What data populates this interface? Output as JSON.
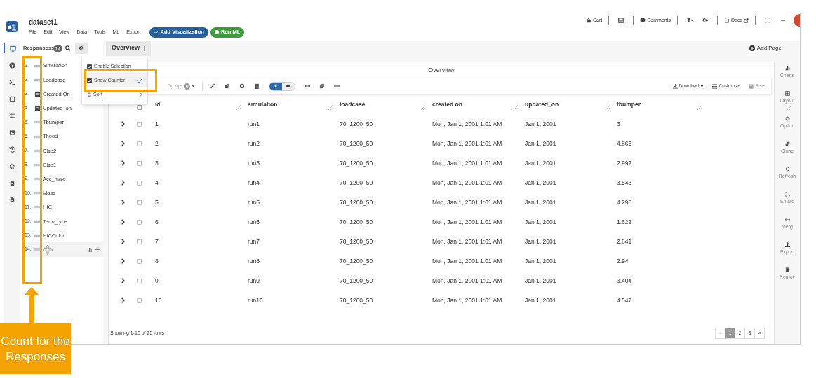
{
  "app": {
    "title": "dataset1",
    "menu": [
      "File",
      "Edit",
      "View",
      "Data",
      "Tools",
      "ML",
      "Export"
    ],
    "buttons": [
      {
        "label": "Add Visualization",
        "kind": "visualize"
      },
      {
        "label": "Run ML",
        "kind": "ml"
      }
    ]
  },
  "topbar": [
    {
      "kind": "cart",
      "label": "Cart"
    },
    {
      "kind": "sep"
    },
    {
      "kind": "table"
    },
    {
      "kind": "sep"
    },
    {
      "kind": "comments",
      "label": "Comments"
    },
    {
      "kind": "sep"
    },
    {
      "kind": "filter"
    },
    {
      "kind": "gear"
    },
    {
      "kind": "sep"
    },
    {
      "kind": "docs",
      "label": "Docs"
    },
    {
      "kind": "sep"
    },
    {
      "kind": "expand"
    },
    {
      "kind": "minimize"
    }
  ],
  "left_rail": [
    {
      "kind": "screen",
      "selected": true
    },
    {
      "kind": "info",
      "selected": false
    },
    {
      "kind": "terminal",
      "selected": false
    },
    {
      "kind": "square",
      "selected": false
    },
    {
      "kind": "sliders",
      "selected": false
    },
    {
      "kind": "image",
      "selected": false
    },
    {
      "kind": "history",
      "selected": false
    },
    {
      "kind": "gear",
      "selected": false
    },
    {
      "kind": "file",
      "selected": false
    },
    {
      "kind": "file",
      "selected": false
    }
  ],
  "responses": {
    "label": "Responses:",
    "count": "14",
    "items": [
      {
        "number": "1.",
        "kind": "text",
        "name": "Simulation",
        "hovered": false
      },
      {
        "number": "2.",
        "kind": "text",
        "name": "Loadcase",
        "hovered": false
      },
      {
        "number": "3.",
        "kind": "date",
        "name": "Created On",
        "hovered": false
      },
      {
        "number": "4.",
        "kind": "date",
        "name": "Updated_on",
        "hovered": false
      },
      {
        "number": "5.",
        "kind": "number",
        "name": "Tbumper",
        "hovered": false
      },
      {
        "number": "6.",
        "kind": "number",
        "name": "Thood",
        "hovered": false
      },
      {
        "number": "7.",
        "kind": "number",
        "name": "Disp2",
        "hovered": false
      },
      {
        "number": "8.",
        "kind": "number",
        "name": "Disp1",
        "hovered": false
      },
      {
        "number": "9.",
        "kind": "number",
        "name": "Acc_max",
        "hovered": false
      },
      {
        "number": "10.",
        "kind": "number",
        "name": "Mass",
        "hovered": false
      },
      {
        "number": "11.",
        "kind": "number",
        "name": "HIC",
        "hovered": false
      },
      {
        "number": "12.",
        "kind": "text",
        "name": "Term_type",
        "hovered": false
      },
      {
        "number": "13.",
        "kind": "text",
        "name": "HICColor",
        "hovered": false
      },
      {
        "number": "14.",
        "kind": "number",
        "hovered": true
      }
    ]
  },
  "settings_menu": [
    {
      "label": "Enable Selection",
      "kind": "checkbox",
      "checked": true,
      "selected": false
    },
    {
      "label": "Show Counter",
      "kind": "checkbox",
      "checked": true,
      "selected": true
    },
    {
      "label": "Sort",
      "kind": "submenu",
      "selected": false
    }
  ],
  "tabs": [
    {
      "label": "Overview",
      "selected": true
    }
  ],
  "add_page": "Add Page",
  "panel": {
    "title": "Overview",
    "groups_label": "Groups",
    "groups_count": "0",
    "actions": [
      {
        "kind": "download",
        "label": "Download"
      },
      {
        "kind": "customize",
        "label": "Customize"
      },
      {
        "kind": "save",
        "label": "Save"
      }
    ]
  },
  "table": {
    "columns": [
      "id",
      "simulation",
      "loadcase",
      "created on",
      "updated_on",
      "tbumper"
    ],
    "rows": [
      [
        "1",
        "run1",
        "70_1200_50",
        "Mon, Jan 1, 2001 1:01 AM",
        "Jan 1, 2001",
        "3"
      ],
      [
        "2",
        "run2",
        "70_1200_50",
        "Mon, Jan 1, 2001 1:01 AM",
        "Jan 1, 2001",
        "4.865"
      ],
      [
        "3",
        "run3",
        "70_1200_50",
        "Mon, Jan 1, 2001 1:01 AM",
        "Jan 1, 2001",
        "2.992"
      ],
      [
        "4",
        "run4",
        "70_1200_50",
        "Mon, Jan 1, 2001 1:01 AM",
        "Jan 1, 2001",
        "3.543"
      ],
      [
        "5",
        "run5",
        "70_1200_50",
        "Mon, Jan 1, 2001 1:01 AM",
        "Jan 1, 2001",
        "4.298"
      ],
      [
        "6",
        "run6",
        "70_1200_50",
        "Mon, Jan 1, 2001 1:01 AM",
        "Jan 1, 2001",
        "1.622"
      ],
      [
        "7",
        "run7",
        "70_1200_50",
        "Mon, Jan 1, 2001 1:01 AM",
        "Jan 1, 2001",
        "2.841"
      ],
      [
        "8",
        "run8",
        "70_1200_50",
        "Mon, Jan 1, 2001 1:01 AM",
        "Jan 1, 2001",
        "2.94"
      ],
      [
        "9",
        "run9",
        "70_1200_50",
        "Mon, Jan 1, 2001 1:01 AM",
        "Jan 1, 2001",
        "3.404"
      ],
      [
        "10",
        "run10",
        "70_1200_50",
        "Mon, Jan 1, 2001 1:01 AM",
        "Jan 1, 2001",
        "4.547"
      ]
    ],
    "footer": "Showing 1-10 of 25 rows",
    "pages": [
      {
        "label": "«",
        "kind": "prev",
        "selected": false
      },
      {
        "label": "1",
        "kind": "page",
        "selected": true
      },
      {
        "label": "2",
        "kind": "page",
        "selected": false
      },
      {
        "label": "3",
        "kind": "page",
        "selected": false
      },
      {
        "label": "»",
        "kind": "next",
        "selected": false
      }
    ]
  },
  "right_rail": [
    {
      "kind": "charts",
      "label": "Charts"
    },
    {
      "kind": "layout",
      "label": "Layout"
    },
    {
      "kind": "options",
      "label": "Option"
    },
    {
      "kind": "clone",
      "label": "Clone"
    },
    {
      "kind": "refresh",
      "label": "Refresh"
    },
    {
      "kind": "enlarge",
      "label": "Enlarg"
    },
    {
      "kind": "merge",
      "label": "Merg"
    },
    {
      "kind": "export",
      "label": "Export"
    },
    {
      "kind": "remove",
      "label": "Remov"
    }
  ],
  "annotation": {
    "text": "Count for the Responses"
  }
}
